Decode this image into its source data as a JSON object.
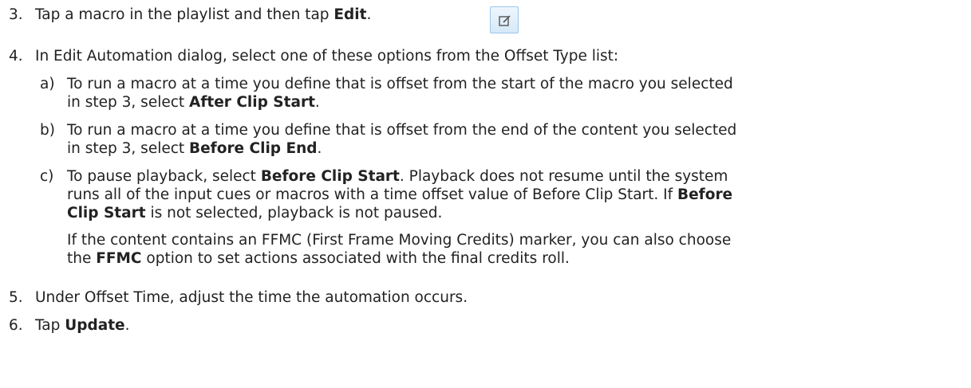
{
  "steps": {
    "s3": {
      "num": "3.",
      "pre": "Tap a macro in the playlist and then tap ",
      "bold": "Edit",
      "post": "."
    },
    "s4": {
      "num": "4.",
      "text": "In Edit Automation dialog, select one of these options from the Offset Type list:"
    },
    "a": {
      "num": "a)",
      "l1": "To run a macro at a time you define that is offset from the start of the macro you selected",
      "l2pre": "in step 3, select ",
      "bold": "After Clip Start",
      "post": "."
    },
    "b": {
      "num": "b)",
      "l1": "To run a macro at a time you define that is offset from the end of the content you selected",
      "l2pre": "in step 3, select ",
      "bold": "Before Clip End",
      "post": "."
    },
    "c": {
      "num": "c)",
      "l1pre": "To pause playback, select ",
      "l1bold": "Before Clip Start",
      "l1post": ". Playback does not resume until the system",
      "l2pre": "runs all of the input cues or macros with a time offset value of Before Clip Start. If ",
      "l2bold": "Before",
      "l3bold": "Clip Start",
      "l3post": " is not selected, playback is not paused.",
      "n1": "If the content contains an FFMC (First Frame Moving Credits) marker, you can also choose",
      "n2pre": "the ",
      "n2bold": "FFMC",
      "n2post": " option to set actions associated with the final credits roll."
    },
    "s5": {
      "num": "5.",
      "text": "Under Offset Time, adjust the time the automation occurs."
    },
    "s6": {
      "num": "6.",
      "pre": "Tap ",
      "bold": "Update",
      "post": "."
    }
  },
  "icons": {
    "edit": "edit-icon"
  }
}
